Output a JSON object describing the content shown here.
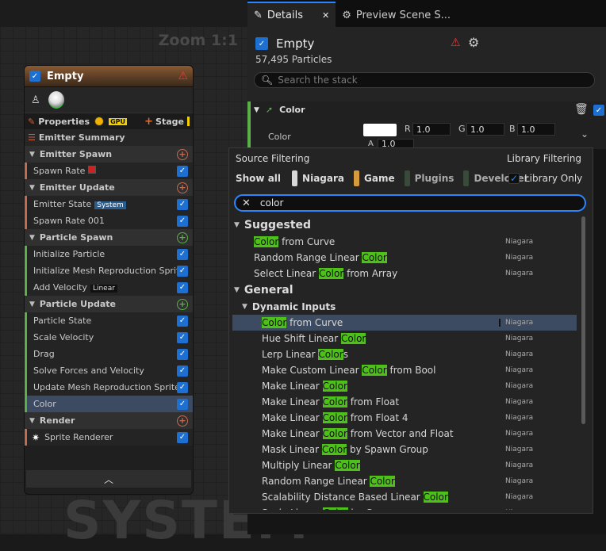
{
  "graph": {
    "zoom": "Zoom 1:1",
    "watermark": "SYSTEM"
  },
  "node": {
    "title": "Empty",
    "properties_label": "Properties",
    "gpu_badge": "GPU",
    "stage_label": "Stage",
    "emitter_summary": "Emitter Summary",
    "sections": [
      {
        "label": "Emitter Spawn",
        "color": "#c46b4e",
        "items": [
          {
            "label": "Spawn Rate",
            "tag": "",
            "red": true
          }
        ]
      },
      {
        "label": "Emitter Update",
        "color": "#c46b4e",
        "items": [
          {
            "label": "Emitter State",
            "tag": "System"
          },
          {
            "label": "Spawn Rate 001",
            "tag": ""
          }
        ]
      },
      {
        "label": "Particle Spawn",
        "color": "#5bb04a",
        "items": [
          {
            "label": "Initialize Particle",
            "tag": ""
          },
          {
            "label": "Initialize Mesh Reproduction Sprite",
            "tag": ""
          },
          {
            "label": "Add Velocity",
            "tag": "Linear"
          }
        ]
      },
      {
        "label": "Particle Update",
        "color": "#5bb04a",
        "items": [
          {
            "label": "Particle State"
          },
          {
            "label": "Scale Velocity"
          },
          {
            "label": "Drag"
          },
          {
            "label": "Solve Forces and Velocity"
          },
          {
            "label": "Update Mesh Reproduction Sprite"
          },
          {
            "label": "Color",
            "selected": true
          }
        ]
      },
      {
        "label": "Render",
        "color": "#c46b4e",
        "items": [
          {
            "label": "Sprite Renderer"
          }
        ]
      }
    ]
  },
  "tabs": {
    "details": "Details",
    "preview": "Preview Scene S..."
  },
  "emitter": {
    "name": "Empty",
    "particles": "57,495 Particles",
    "search_placeholder": "Search the stack"
  },
  "color_module": {
    "header": "Color",
    "row_label": "Color",
    "r_label": "R",
    "r": "1.0",
    "g_label": "G",
    "g": "1.0",
    "b_label": "B",
    "b": "1.0",
    "a_label": "A",
    "a": "1.0"
  },
  "popup": {
    "source_filtering": "Source Filtering",
    "library_filtering": "Library Filtering",
    "show_all": "Show all",
    "chips": [
      {
        "label": "Niagara",
        "color": "#d8d8d8"
      },
      {
        "label": "Game",
        "color": "#d49a3c"
      },
      {
        "label": "Plugins",
        "color": "#3a4a3a"
      },
      {
        "label": "Developer",
        "color": "#3a4a3a"
      }
    ],
    "library_only": "Library Only",
    "filter_value": "color",
    "suggested_label": "Suggested",
    "general_label": "General",
    "dynamic_inputs_label": "Dynamic Inputs",
    "suggested": [
      {
        "pre": "",
        "hl": "Color",
        "post": " from Curve",
        "src": "Niagara"
      },
      {
        "pre": "Random Range Linear ",
        "hl": "Color",
        "post": "",
        "src": "Niagara"
      },
      {
        "pre": "Select Linear ",
        "hl": "Color",
        "post": " from Array",
        "src": "Niagara"
      }
    ],
    "dynamic": [
      {
        "pre": "",
        "hl": "Color",
        "post": " from Curve",
        "src": "Niagara",
        "selected": true
      },
      {
        "pre": "Hue Shift Linear ",
        "hl": "Color",
        "post": "",
        "src": "Niagara"
      },
      {
        "pre": "Lerp Linear ",
        "hl": "Color",
        "post": "s",
        "src": "Niagara"
      },
      {
        "pre": "Make Custom Linear ",
        "hl": "Color",
        "post": " from Bool",
        "src": "Niagara"
      },
      {
        "pre": "Make Linear ",
        "hl": "Color",
        "post": "",
        "src": "Niagara"
      },
      {
        "pre": "Make Linear ",
        "hl": "Color",
        "post": " from Float",
        "src": "Niagara"
      },
      {
        "pre": "Make Linear ",
        "hl": "Color",
        "post": " from Float 4",
        "src": "Niagara"
      },
      {
        "pre": "Make Linear ",
        "hl": "Color",
        "post": " from Vector and Float",
        "src": "Niagara"
      },
      {
        "pre": "Mask Linear ",
        "hl": "Color",
        "post": " by Spawn Group",
        "src": "Niagara"
      },
      {
        "pre": "Multiply Linear ",
        "hl": "Color",
        "post": "",
        "src": "Niagara"
      },
      {
        "pre": "Random Range Linear ",
        "hl": "Color",
        "post": "",
        "src": "Niagara"
      },
      {
        "pre": "Scalability Distance Based Linear ",
        "hl": "Color",
        "post": "",
        "src": "Niagara"
      },
      {
        "pre": "Scale Linear ",
        "hl": "Color",
        "post": " by Curve",
        "src": "Niagara"
      }
    ]
  }
}
